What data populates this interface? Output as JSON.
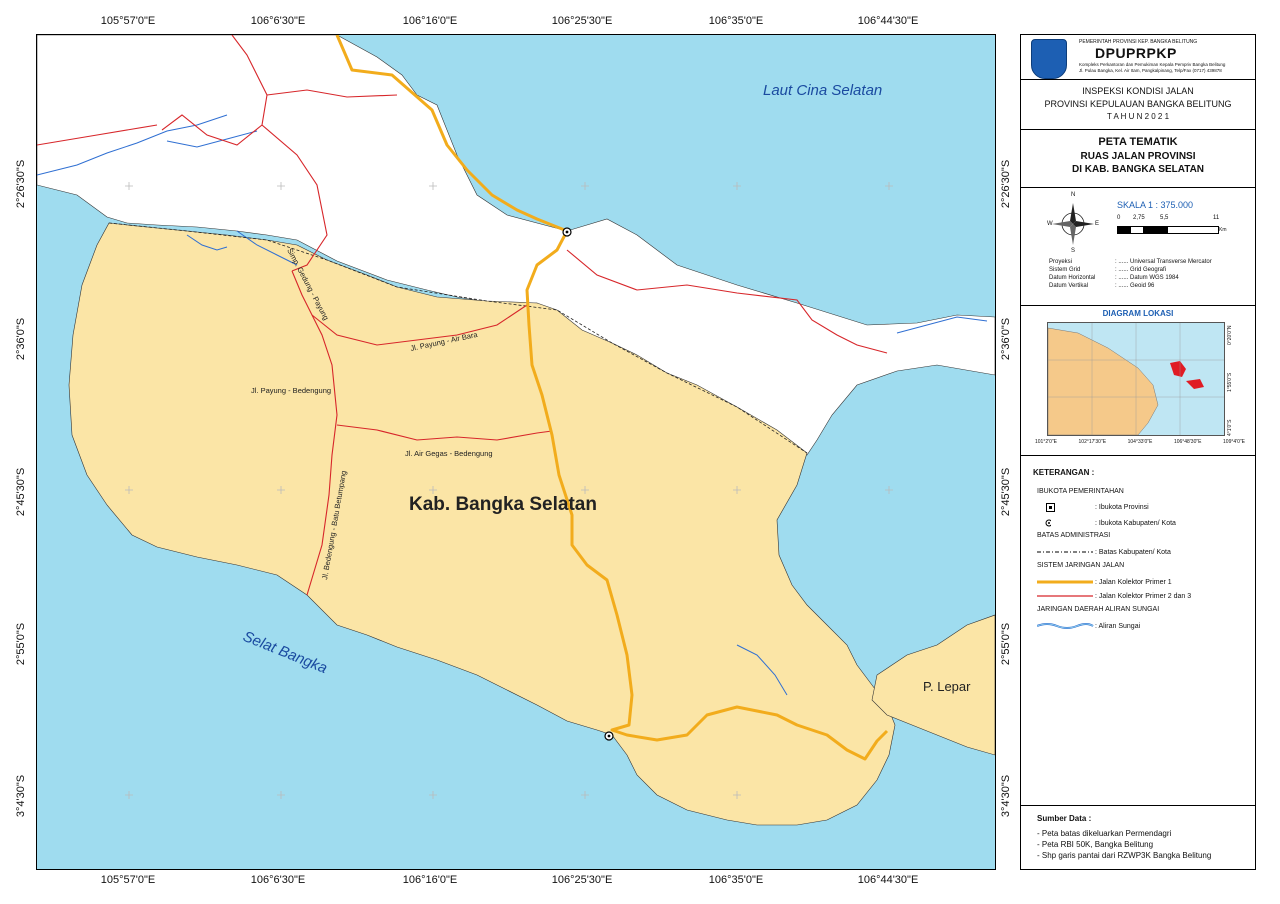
{
  "coords": {
    "top": [
      "105°57'0\"E",
      "106°6'30\"E",
      "106°16'0\"E",
      "106°25'30\"E",
      "106°35'0\"E",
      "106°44'30\"E"
    ],
    "bottom": [
      "105°57'0\"E",
      "106°6'30\"E",
      "106°16'0\"E",
      "106°25'30\"E",
      "106°35'0\"E",
      "106°44'30\"E"
    ],
    "left": [
      "2°26'30\"S",
      "2°36'0\"S",
      "2°45'30\"S",
      "2°55'0\"S",
      "3°4'30\"S"
    ],
    "right": [
      "2°26'30\"S",
      "2°36'0\"S",
      "2°45'30\"S",
      "2°55'0\"S",
      "3°4'30\"S"
    ]
  },
  "map": {
    "sea_north": "Laut Cina Selatan",
    "sea_south": "Selat Bangka",
    "regency": "Kab. Bangka Selatan",
    "island": "P. Lepar",
    "roads": {
      "r1": "Simp. Gedung - Payung",
      "r2": "Jl. Payung - Air Bara",
      "r3": "Jl. Payung - Bedengung",
      "r4": "Jl. Air Gegas - Bedengung",
      "r5": "Jl. Bedengung - Batu Betumpang"
    },
    "colors": {
      "sea": "#9fdcef",
      "land_south": "#fbe5a6",
      "land_other": "#ffffff",
      "primary_road": "#f2ac1c",
      "secondary_road": "#d7262a",
      "river": "#2f6fd2"
    }
  },
  "panel": {
    "agency_line1": "PEMERINTAH PROVINSI KEP. BANGKA BELITUNG",
    "agency_name": "DPUPRPKP",
    "agency_line2": "Kompleks Perkantoran dan Pemukiman Kepala Pempriv Bangka Belitung",
    "agency_line3": "Jl. Pulau Bangka, Kel. Air Itam, Pangkalpinang, Telp/Fax (0717) 439878",
    "inspection_1": "INSPEKSI KONDISI JALAN",
    "inspection_2": "PROVINSI KEPULAUAN BANGKA BELITUNG",
    "inspection_3": "T A H U N  2 0 2 1",
    "title_1": "PETA TEMATIK",
    "title_2": "RUAS JALAN PROVINSI",
    "title_3": "DI KAB. BANGKA SELATAN",
    "scale": "SKALA 1 : 375.000",
    "scale_ticks": [
      "0",
      "2,75",
      "5,5",
      "11"
    ],
    "scale_unit": "Km",
    "compass": {
      "n": "N",
      "s": "S",
      "e": "E",
      "w": "W"
    },
    "proj": [
      {
        "k": "Proyeksi",
        "v": ": ...... Universal Transverse Mercator"
      },
      {
        "k": "Sistem Grid",
        "v": ": ...... Grid Geografi"
      },
      {
        "k": "Datum Horizontal",
        "v": ": ...... Datum WGS 1984"
      },
      {
        "k": "Datum Vertikal",
        "v": ": ...... Geoid 96"
      }
    ],
    "locator_title": "DIAGRAM LOKASI",
    "locator_x": [
      "101°2'0\"E",
      "102°17'30\"E",
      "104°33'0\"E",
      "106°48'30\"E",
      "109°4'0\"E"
    ],
    "locator_y": [
      "0°20'0\"N",
      "1°55'0\"S",
      "4°1'0\"S"
    ],
    "legend_title": "KETERANGAN :",
    "legend": {
      "h1": "IBUKOTA PEMERINTAHAN",
      "i1": ": Ibukota Provinsi",
      "i2": ": Ibukota Kabupaten/ Kota",
      "h2": "BATAS ADMINISTRASI",
      "i3": ": Batas Kabupaten/ Kota",
      "h3": "SISTEM JARINGAN JALAN",
      "i4": ": Jalan Kolektor Primer 1",
      "i5": ": Jalan Kolektor Primer 2 dan 3",
      "h4": "JARINGAN DAERAH ALIRAN SUNGAI",
      "i6": ": Aliran Sungai"
    },
    "source_title": "Sumber Data :",
    "sources": [
      "- Peta batas dikeluarkan Permendagri",
      "- Peta RBI 50K, Bangka Belitung",
      "- Shp garis pantai dari RZWP3K Bangka Belitung"
    ]
  }
}
